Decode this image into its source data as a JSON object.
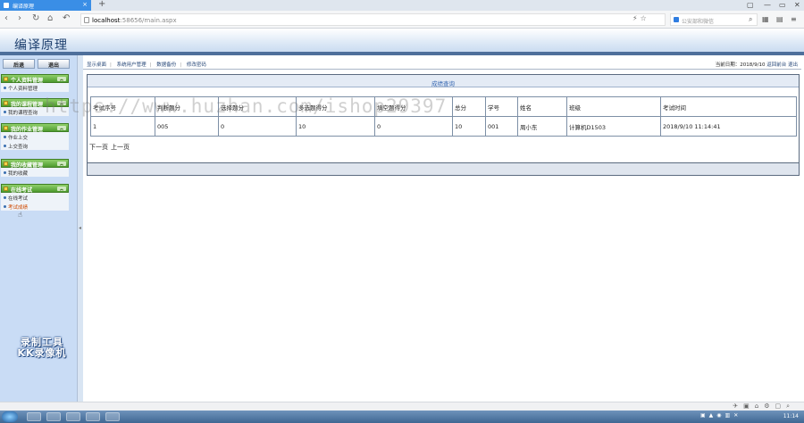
{
  "browser": {
    "tab_title": "编译原理",
    "new_tab": "+",
    "url_host": "localhost",
    "url_path": ":58656/main.aspx",
    "search_placeholder": "公安部和微信",
    "window_controls": [
      "▢",
      "—",
      "▭",
      "✕"
    ]
  },
  "app": {
    "title": "编译原理"
  },
  "sidebar": {
    "back_label": "后退",
    "logout_label": "退出",
    "menus": [
      {
        "title": "个人资料管理",
        "items": [
          "个人资料管理"
        ]
      },
      {
        "title": "我的课程管理",
        "items": [
          "我的课程查询"
        ]
      },
      {
        "title": "我的作业管理",
        "items": [
          "作业上交",
          "上交查询"
        ]
      },
      {
        "title": "我的收藏管理",
        "items": [
          "我的收藏"
        ]
      },
      {
        "title": "在线考试",
        "items": [
          "在线考试",
          "考试成绩"
        ]
      }
    ],
    "watermark_line1": "录制工具",
    "watermark_line2": "KK录像机"
  },
  "toolbar": {
    "links": [
      "显示桌面",
      "系统用户管理",
      "数据备份",
      "修改密码"
    ],
    "date_label": "当前日期：2018/9/10",
    "back_link": "返回前台",
    "exit_link": "退出"
  },
  "panel": {
    "title": "成绩查询"
  },
  "grid": {
    "headers": [
      "考试序号",
      "判断题分",
      "选择题分",
      "多选题得分",
      "填空题得分",
      "总分",
      "学号",
      "姓名",
      "班级",
      "考试时间"
    ],
    "rows": [
      [
        "1",
        "005",
        "0",
        "10",
        "0",
        "10",
        "001",
        "周小东",
        "计算机D1503",
        "2018/9/10 11:14:41"
      ]
    ]
  },
  "pager": {
    "next": "下一页",
    "prev": "上一页"
  },
  "overlay_watermark": "https://www.huzhan.com/ishop29397",
  "taskbar": {
    "clock": "11:14"
  }
}
